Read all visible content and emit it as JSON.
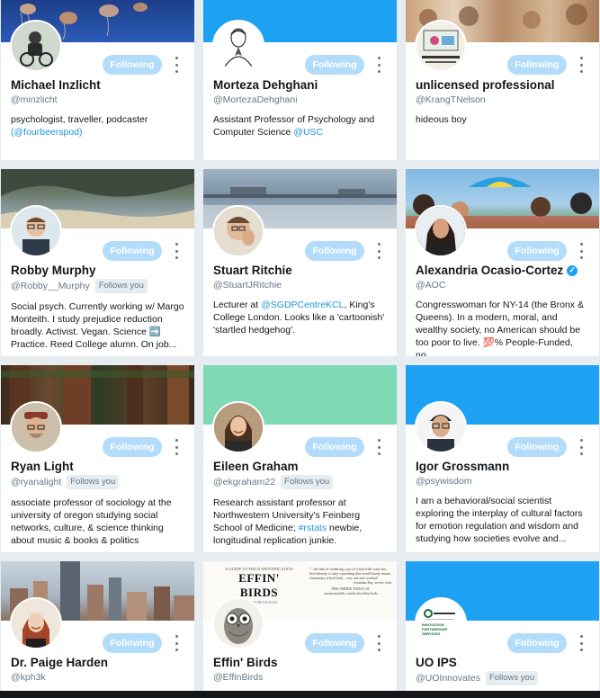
{
  "ui": {
    "following_label": "Following",
    "follows_you_label": "Follows you",
    "accent_color": "#1da1f2",
    "button_color": "#b3dcfa"
  },
  "cards": [
    {
      "name": "Michael Inzlicht",
      "handle": "@minzlicht",
      "follows_you": false,
      "verified": false,
      "bio": [
        "psychologist, traveller, podcaster",
        "(",
        "@fourbeerspod",
        ")"
      ],
      "banner_icon": "jellyfish-banner",
      "avatar_icon": "bike-avatar"
    },
    {
      "name": "Morteza Dehghani",
      "handle": "@MortezaDehghani",
      "follows_you": false,
      "verified": false,
      "bio": [
        "Assistant Professor of Psychology and Computer Science ",
        "@USC"
      ],
      "banner_icon": "solid-blue-banner",
      "avatar_icon": "sketch-avatar"
    },
    {
      "name": "unlicensed professional",
      "handle": "@KrangTNelson",
      "follows_you": false,
      "verified": false,
      "bio": [
        "hideous boy"
      ],
      "banner_icon": "crowd-banner",
      "avatar_icon": "sign-avatar"
    },
    {
      "name": "Robby Murphy",
      "handle": "@Robby__Murphy",
      "follows_you": true,
      "verified": false,
      "bio": [
        "Social psych. Currently working w/ Margo Monteith. I study prejudice reduction broadly. Activist. Vegan. Science ",
        "➡️",
        " Practice. Reed College alumn. On job..."
      ],
      "banner_icon": "coast-banner",
      "avatar_icon": "glasses-avatar"
    },
    {
      "name": "Stuart Ritchie",
      "handle": "@StuartJRitchie",
      "follows_you": false,
      "verified": false,
      "bio": [
        "Lecturer at ",
        "@SGDPCentreKCL",
        ", King's College London. Looks like a 'cartoonish' 'startled hedgehog'."
      ],
      "banner_icon": "water-banner",
      "avatar_icon": "hand-face-avatar"
    },
    {
      "name": "Alexandria Ocasio-Cortez",
      "handle": "@AOC",
      "follows_you": false,
      "verified": true,
      "bio": [
        "Congresswoman for NY-14 (the Bronx & Queens). In a modern, moral, and wealthy society, no American should be too poor to live. ",
        "💯",
        "% People-Funded, no..."
      ],
      "banner_icon": "umbrella-crowd-banner",
      "avatar_icon": "portrait-avatar"
    },
    {
      "name": "Ryan Light",
      "handle": "@ryanalight",
      "follows_you": true,
      "verified": false,
      "bio": [
        "associate professor of sociology at the university of oregon studying social networks, culture, & science thinking about music & books & politics"
      ],
      "banner_icon": "redwood-banner",
      "avatar_icon": "hat-avatar"
    },
    {
      "name": "Eileen Graham",
      "handle": "@ekgraham22",
      "follows_you": true,
      "verified": false,
      "bio": [
        "Research assistant professor at Northwestern University's Feinberg School of Medicine; ",
        "#rstats",
        " newbie, longitudinal replication junkie."
      ],
      "banner_icon": "mint-banner",
      "avatar_icon": "smile-avatar"
    },
    {
      "name": "Igor Grossmann",
      "handle": "@psywisdom",
      "follows_you": false,
      "verified": false,
      "bio": [
        "I am a behavioral/social scientist exploring the interplay of cultural factors for emotion regulation and wisdom and studying how societies evolve and..."
      ],
      "banner_icon": "solid-blue-banner",
      "avatar_icon": "glasses-man-avatar"
    },
    {
      "name": "Dr. Paige Harden",
      "handle": "@kph3k",
      "follows_you": false,
      "verified": false,
      "bio": [],
      "banner_icon": "city-banner",
      "avatar_icon": "redhead-avatar"
    },
    {
      "name": "Effin' Birds",
      "handle": "@EffinBirds",
      "follows_you": false,
      "verified": false,
      "bio": [],
      "banner_icon": "book-banner",
      "avatar_icon": "owl-avatar",
      "banner_text": {
        "kicker": "A GUIDE TO FIELD IDENTIFICATION",
        "title": "EFFIN' BIRDS",
        "byline": "BY ARON REYNALDS",
        "quote": "\"...the idea of rendering a pic of a bird with some key bird-identity is truly something that would barely amuse elementary school kids... very sad and cerebral\"",
        "attribution": "-Jonathan Ray, severe critic",
        "preorder": "PRE-ORDER TODAY AT",
        "url": "aaronreynolds.com/books/effin-birds"
      }
    },
    {
      "name": "UO IPS",
      "handle": "@UOInnovates",
      "follows_you": true,
      "verified": false,
      "bio": [],
      "banner_icon": "solid-blue-banner",
      "avatar_icon": "uo-logo-avatar",
      "avatar_text": "INNOVATION PARTNERSHIP SERVICES"
    }
  ]
}
